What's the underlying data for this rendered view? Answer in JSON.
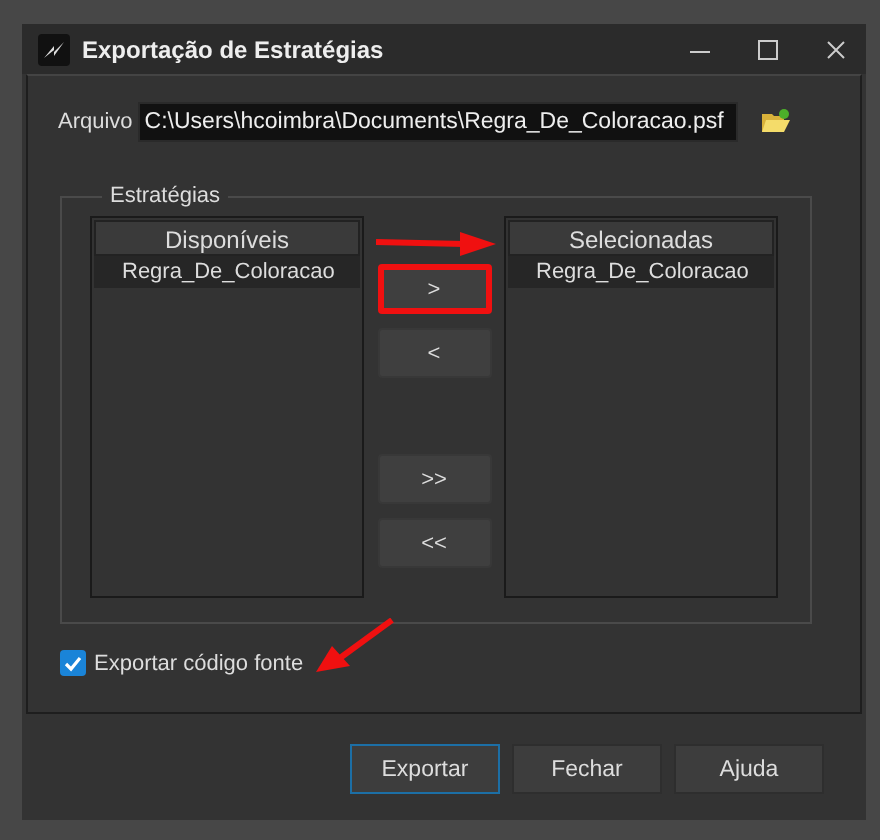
{
  "window": {
    "title": "Exportação de Estratégias"
  },
  "file": {
    "label": "Arquivo",
    "value": "C:\\Users\\hcoimbra\\Documents\\Regra_De_Coloracao.psf"
  },
  "group": {
    "title": "Estratégias",
    "available": {
      "heading": "Disponíveis",
      "items": [
        {
          "label": "Regra_De_Coloracao",
          "selected": true
        }
      ]
    },
    "transfer_buttons": [
      {
        "label": ">",
        "highlighted": true
      },
      {
        "label": "<",
        "highlighted": false
      },
      {
        "label": ">>",
        "highlighted": false
      },
      {
        "label": "<<",
        "highlighted": false
      }
    ],
    "chosen": {
      "heading": "Selecionadas",
      "items": [
        {
          "label": "Regra_De_Coloracao",
          "selected": true
        }
      ]
    }
  },
  "export_source": {
    "label": "Exportar código fonte",
    "checked": true
  },
  "buttons": [
    {
      "label": "Exportar",
      "focused": true
    },
    {
      "label": "Fechar",
      "focused": false
    },
    {
      "label": "Ajuda",
      "focused": false
    }
  ]
}
